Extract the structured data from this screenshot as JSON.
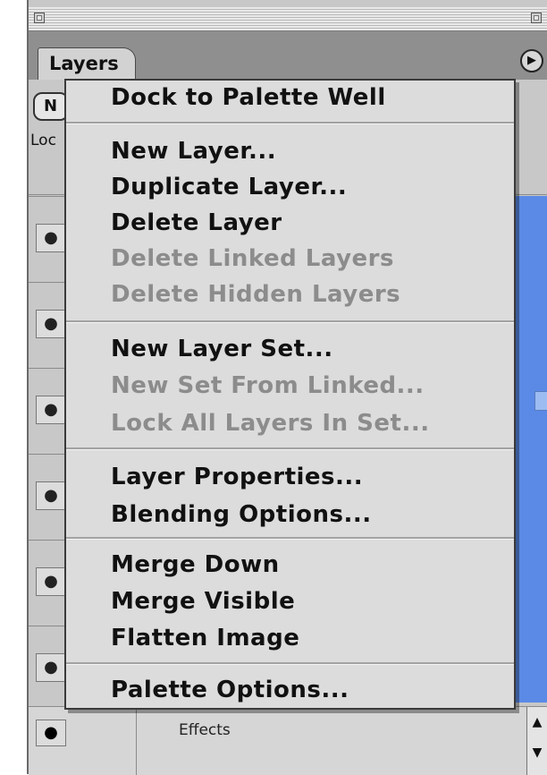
{
  "palette": {
    "tab_label": "Layers",
    "new_button_label": "N",
    "lock_label": "Loc",
    "effects_label": "Effects"
  },
  "menu": {
    "items": [
      {
        "label": "Dock to Palette Well",
        "enabled": true
      },
      {
        "label": "New Layer...",
        "enabled": true
      },
      {
        "label": "Duplicate Layer...",
        "enabled": true
      },
      {
        "label": "Delete Layer",
        "enabled": true
      },
      {
        "label": "Delete Linked Layers",
        "enabled": false
      },
      {
        "label": "Delete Hidden Layers",
        "enabled": false
      },
      {
        "label": "New Layer Set...",
        "enabled": true
      },
      {
        "label": "New Set From Linked...",
        "enabled": false
      },
      {
        "label": "Lock All Layers In Set...",
        "enabled": false
      },
      {
        "label": "Layer Properties...",
        "enabled": true
      },
      {
        "label": "Blending Options...",
        "enabled": true
      },
      {
        "label": "Merge Down",
        "enabled": true
      },
      {
        "label": "Merge Visible",
        "enabled": true
      },
      {
        "label": "Flatten Image",
        "enabled": true
      },
      {
        "label": "Palette Options...",
        "enabled": true
      }
    ]
  },
  "colors": {
    "selection_blue": "#5a8ae6",
    "menu_background": "#dcdcdc",
    "disabled_text": "#8c8c8c"
  },
  "icons": {
    "visibility": "eye-icon",
    "palette_menu": "triangle-right-icon",
    "scroll_up": "arrow-up-icon",
    "scroll_down": "arrow-down-icon"
  }
}
